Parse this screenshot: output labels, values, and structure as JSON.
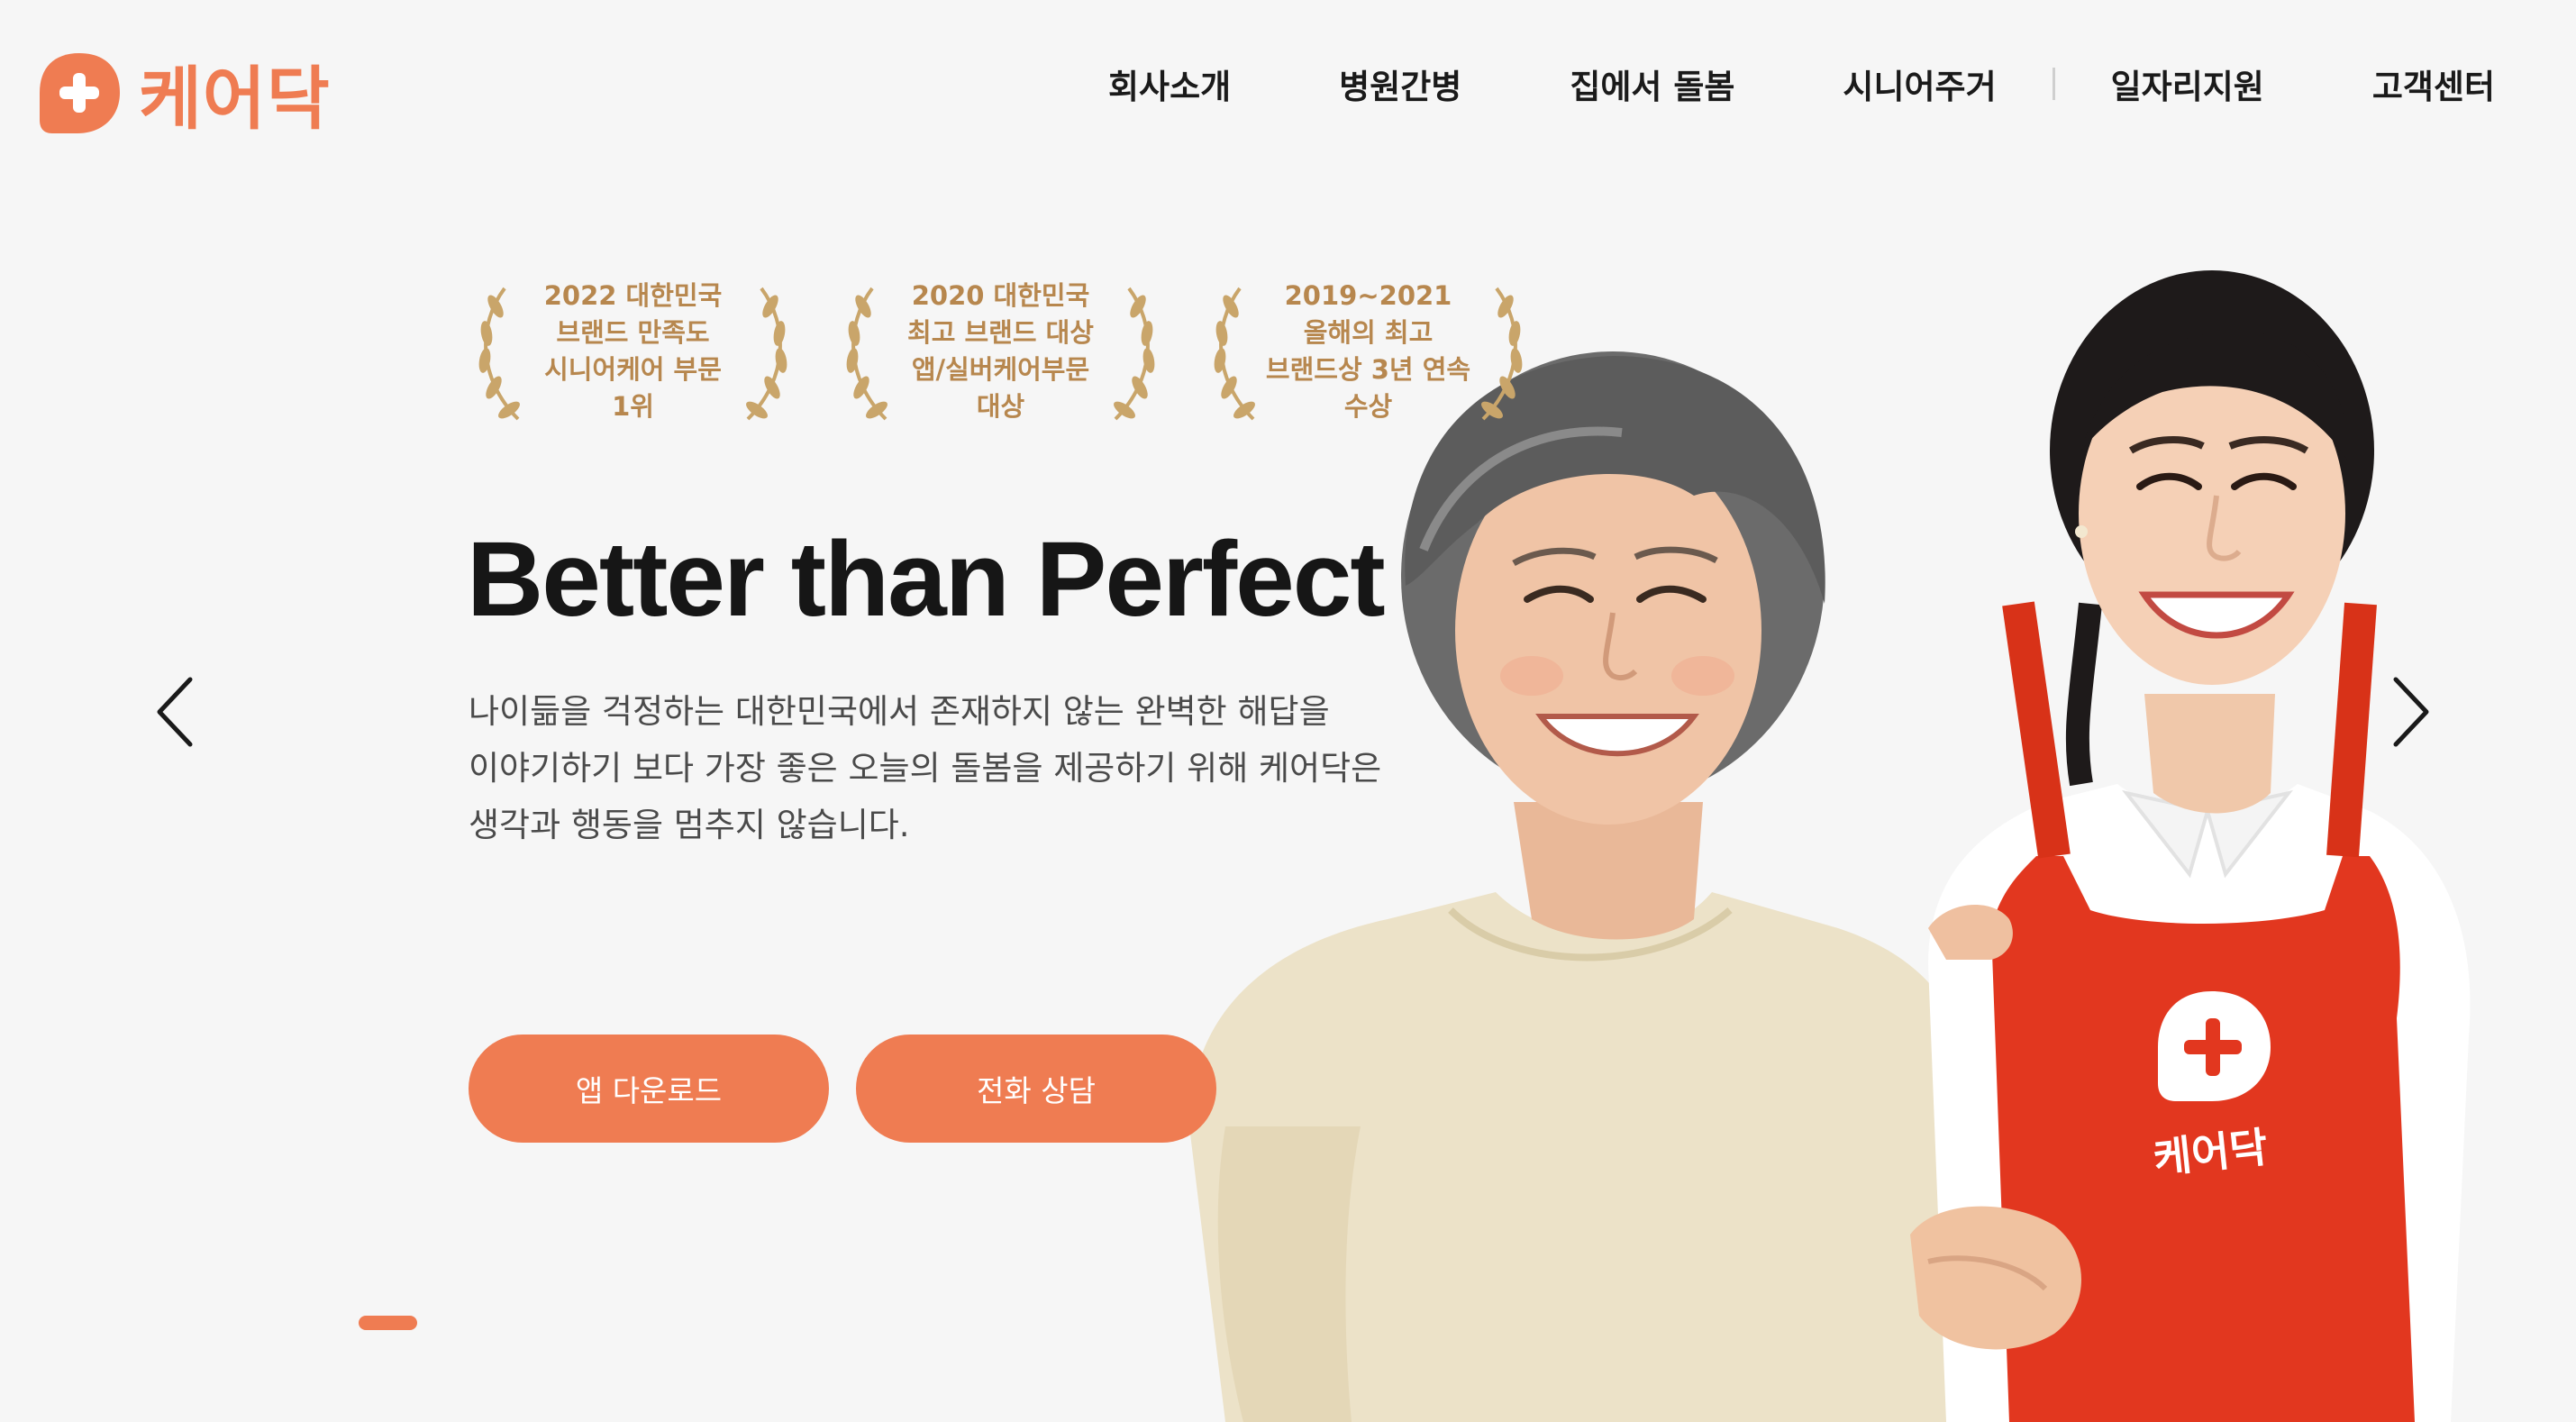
{
  "brand": {
    "name": "케어닥",
    "accent_color": "#ef7c52"
  },
  "nav": {
    "items": [
      {
        "label": "회사소개"
      },
      {
        "label": "병원간병"
      },
      {
        "label": "집에서 돌봄"
      },
      {
        "label": "시니어주거"
      },
      {
        "label": "일자리지원"
      },
      {
        "label": "고객센터"
      }
    ]
  },
  "awards": [
    {
      "lines": [
        "2022 대한민국",
        "브랜드 만족도",
        "시니어케어 부문",
        "1위"
      ]
    },
    {
      "lines": [
        "2020 대한민국",
        "최고 브랜드 대상",
        "앱/실버케어부문",
        "대상"
      ]
    },
    {
      "lines": [
        "2019~2021",
        "올해의 최고",
        "브랜드상 3년 연속",
        "수상"
      ]
    }
  ],
  "hero": {
    "headline": "Better than Perfect",
    "body_lines": [
      "나이듦을 걱정하는 대한민국에서 존재하지 않는 완벽한 해답을",
      "이야기하기 보다 가장 좋은 오늘의 돌봄을 제공하기 위해 케어닥은",
      "생각과 행동을 멈추지 않습니다."
    ],
    "buttons": {
      "app_download": "앱 다운로드",
      "phone_consult": "전화 상담"
    },
    "apron_logo_text": "케어닥"
  },
  "carousel": {
    "prev_icon": "chevron-left-icon",
    "next_icon": "chevron-right-icon"
  }
}
